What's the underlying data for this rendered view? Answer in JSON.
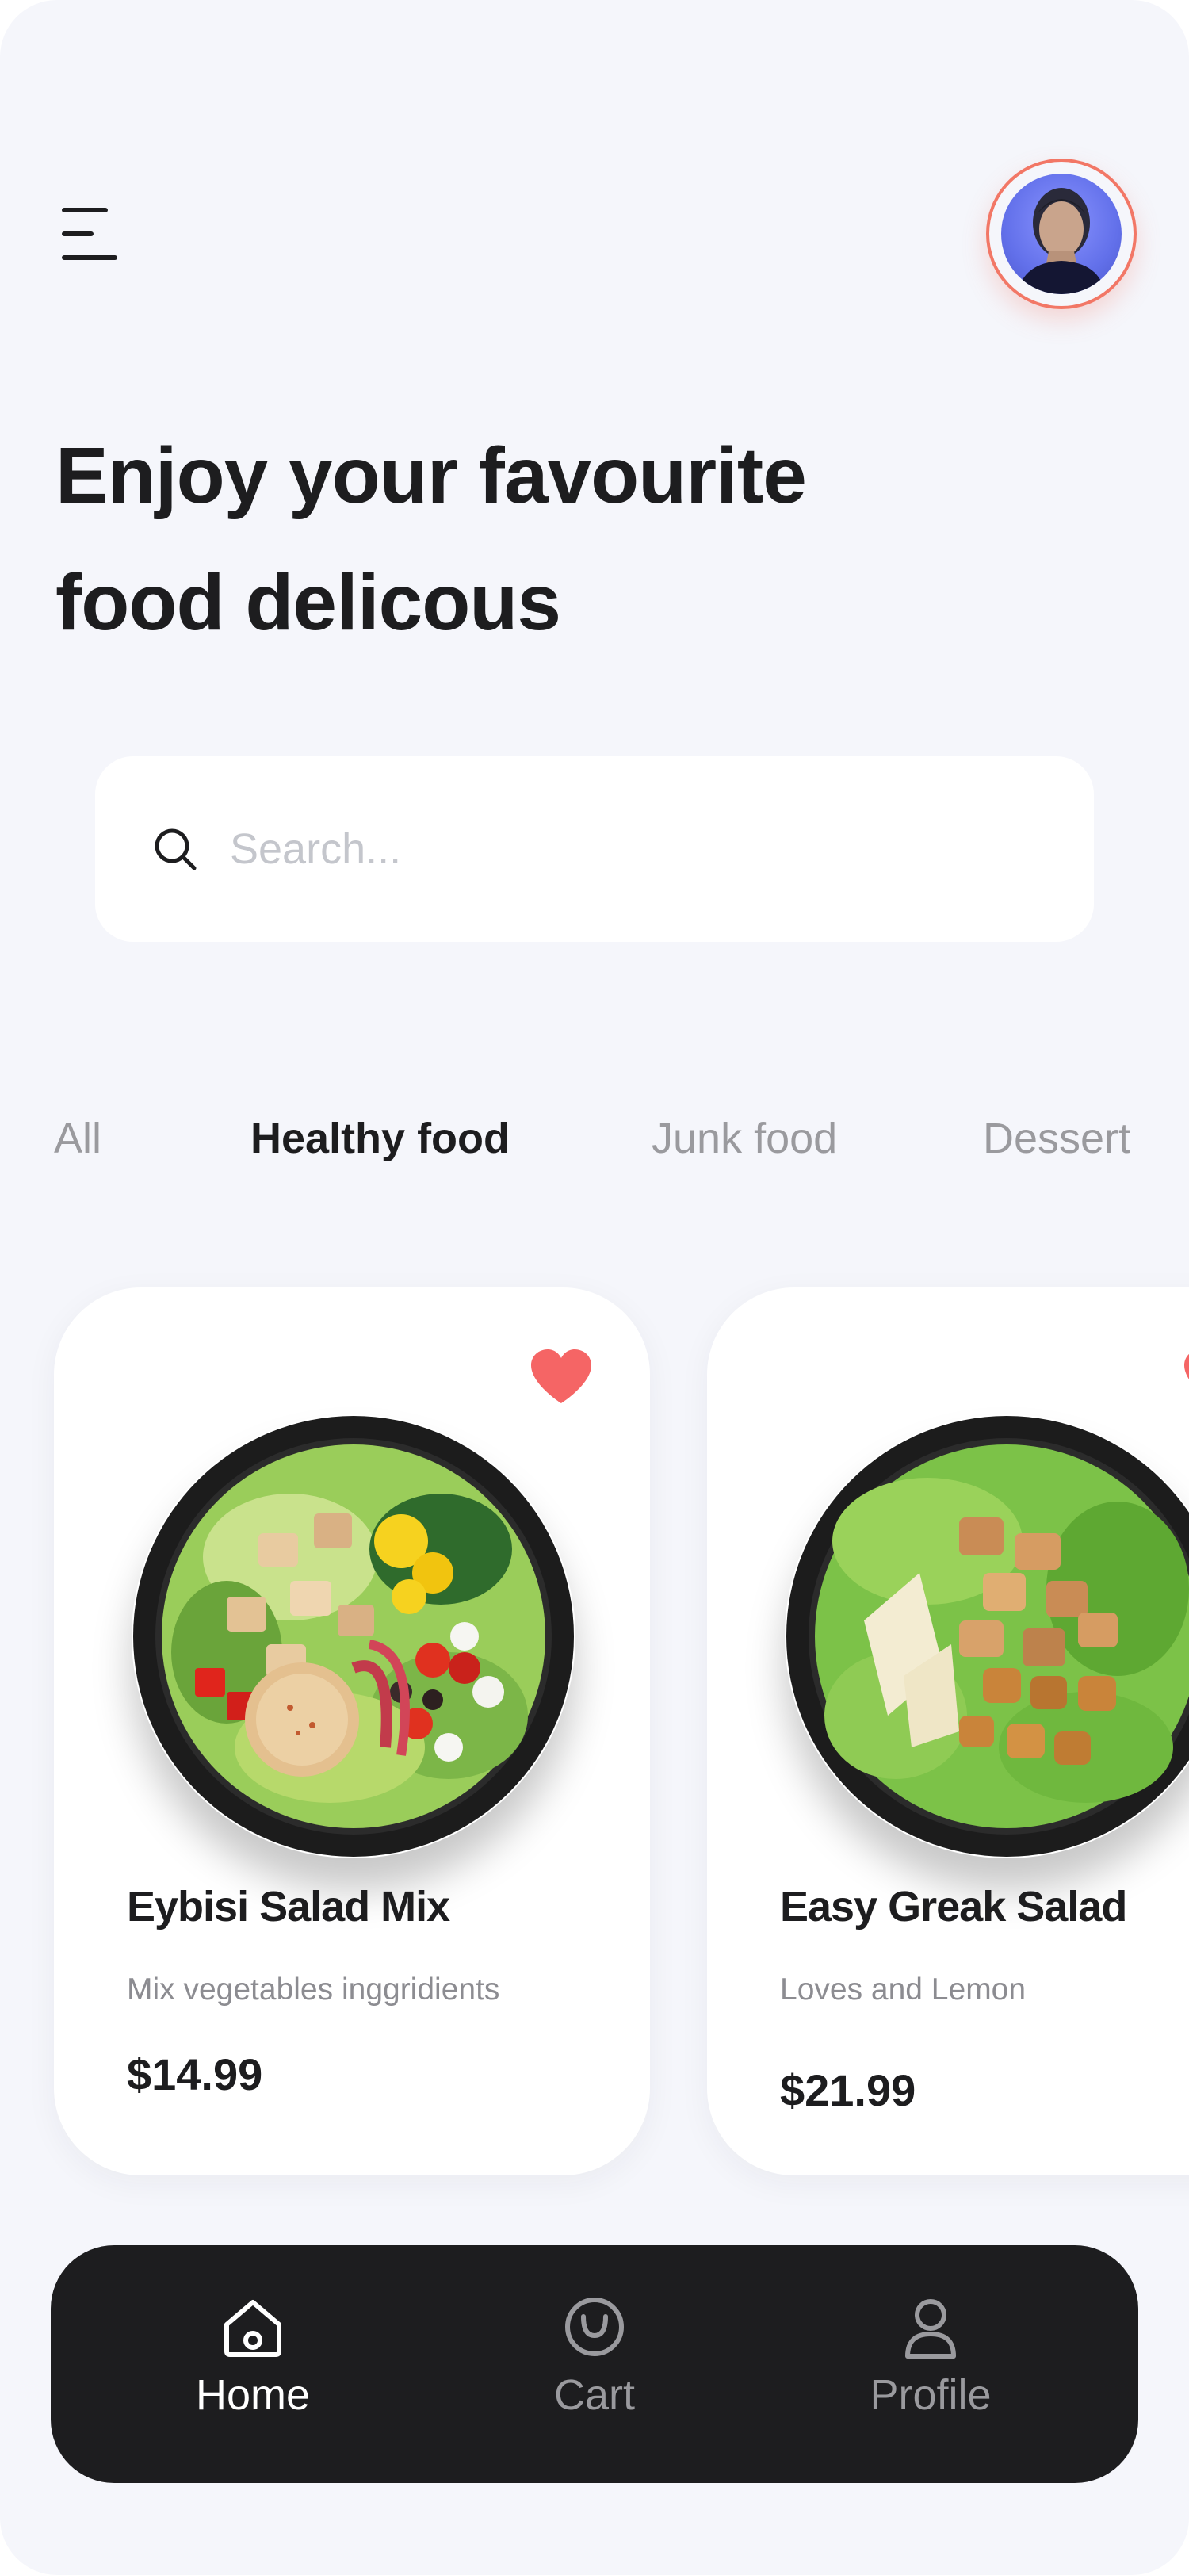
{
  "header": {
    "headline_line1": "Enjoy your favourite",
    "headline_line2": "food delicous"
  },
  "search": {
    "placeholder": "Search..."
  },
  "categories": [
    {
      "label": "All",
      "active": false
    },
    {
      "label": "Healthy food",
      "active": true
    },
    {
      "label": "Junk food",
      "active": false
    },
    {
      "label": "Dessert",
      "active": false
    }
  ],
  "products": [
    {
      "name": "Eybisi Salad Mix",
      "description": "Mix vegetables inggridients",
      "price": "$14.99",
      "favorite": true,
      "icon": "heart-icon"
    },
    {
      "name": "Easy Greak Salad",
      "description": "Loves and Lemon",
      "price": "$21.99",
      "favorite": true,
      "icon": "heart-icon"
    }
  ],
  "nav": {
    "items": [
      {
        "label": "Home",
        "icon": "home-icon",
        "active": true
      },
      {
        "label": "Cart",
        "icon": "cart-icon",
        "active": false
      },
      {
        "label": "Profile",
        "icon": "profile-icon",
        "active": false
      }
    ]
  },
  "colors": {
    "background": "#f5f6fb",
    "accent": "#f27766",
    "heart": "#f56565",
    "text_primary": "#1d1d1f",
    "text_muted": "#9a9a9e",
    "nav_background": "#1d1d1f"
  }
}
